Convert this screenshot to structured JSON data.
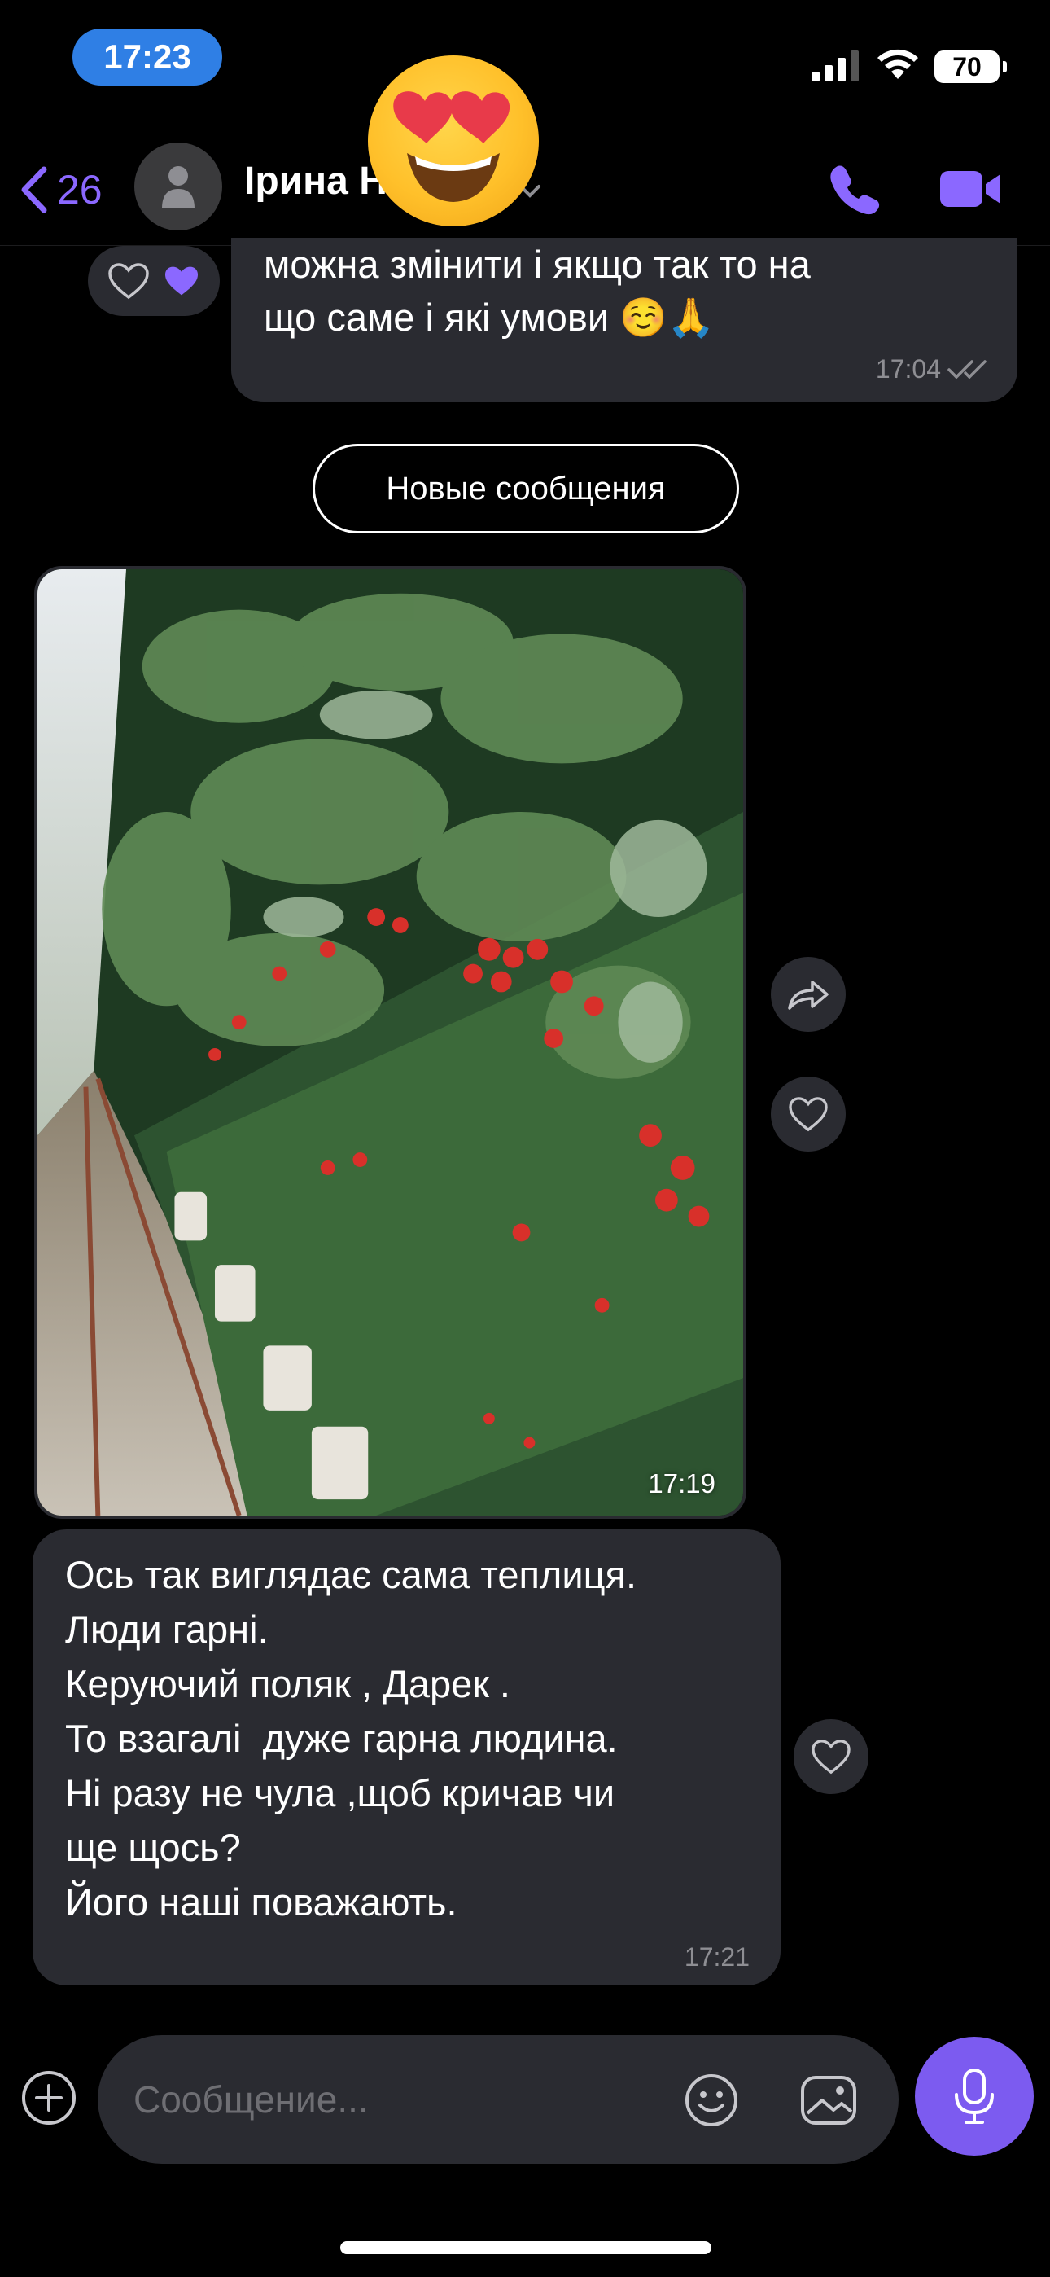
{
  "status_bar": {
    "time": "17:23",
    "battery": "70"
  },
  "header": {
    "back_count": "26",
    "contact_name": "Ірина Н"
  },
  "messages": {
    "outgoing": {
      "text": "можна змінити і якщо так то на\nщо саме і які умови ☺️🙏",
      "time": "17:04"
    },
    "divider_label": "Новые сообщения",
    "photo": {
      "time": "17:19"
    },
    "incoming": {
      "text": "Ось так виглядає сама теплиця.\nЛюди гарні.\nКеруючий поляк , Дарек .\nТо взагалі  дуже гарна людина.\nНі разу не чула ,щоб кричав чи\nще щось?\nЙого наші поважають.",
      "time": "17:21"
    }
  },
  "composer": {
    "placeholder": "Сообщение..."
  },
  "colors": {
    "accent": "#7c5bf0",
    "bubble": "#2a2b31",
    "status_pill": "#2f7fe5"
  }
}
